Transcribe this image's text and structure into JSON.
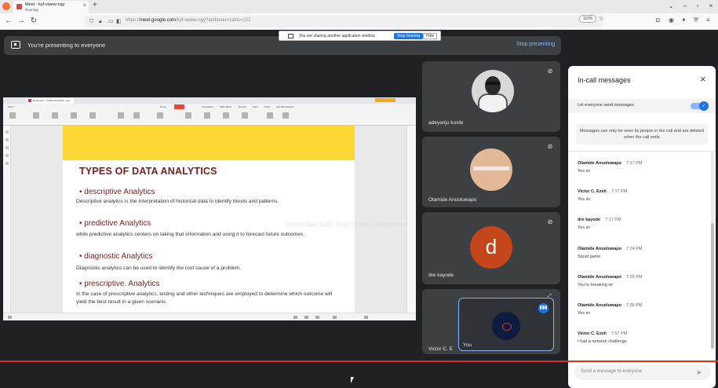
{
  "browser": {
    "tab_title": "Meet - kyf-vwew-ngy",
    "tab_subtitle": "Running",
    "url_prefix": "https://",
    "url_host": "meet.google.com",
    "url_path": "/kyf-vwew-ngy?authuser=1&hs=122",
    "zoom": "110%"
  },
  "share_notice": {
    "text": "You are sharing another application window.",
    "stop_label": "Stop Sharing",
    "hide_label": "Hide"
  },
  "presenting_bar": {
    "text": "You're presenting to everyone",
    "stop_label": "Stop presenting"
  },
  "shared_screen": {
    "app_tab": "Document - TYPES OF DATA...pptx",
    "menus": [
      "Menu",
      "Home",
      "Insert",
      "Animations",
      "Slide Show",
      "Review",
      "View",
      "Tools",
      "Special Features"
    ],
    "slide": {
      "title": "TYPES OF DATA ANALYTICS",
      "sections": [
        {
          "heading": "descriptive Analytics",
          "body": "Descriptive analytics is the interpretation of historical data to identify trends and patterns."
        },
        {
          "heading": "predictive Analytics",
          "body": "while predictive analytics centers on taking that information and using it to forecast future outcomes."
        },
        {
          "heading": "diagnostic Analytics",
          "body": "Diagnostic analytics can be used to identify the root cause of a problem."
        },
        {
          "heading": "prescriptive. Analytics",
          "body": "In the case of prescriptive analytics, testing and other techniques are employed to determine which outcome will yield the best result in a given scenario."
        }
      ]
    }
  },
  "watermark": "Recorded with iTop Screen Recorder",
  "participants": [
    {
      "name": "adeyanju tunde"
    },
    {
      "name": "Olamide Anuoluwapo"
    },
    {
      "name": "dre kayode",
      "initial": "d"
    },
    {
      "name": "Victor C. E"
    }
  ],
  "self": {
    "name": "You"
  },
  "chat": {
    "title": "In-call messages",
    "toggle_label": "Let everyone send messages",
    "notice": "Messages can only be seen by people in the call and are deleted when the call ends",
    "input_placeholder": "Send a message to everyone",
    "messages": [
      {
        "sender": "Olamide Anuoluwapo",
        "time": "7:17 PM",
        "text": "Yes sir"
      },
      {
        "sender": "Victor C. Ezeh",
        "time": "7:17 PM",
        "text": "Yes sir."
      },
      {
        "sender": "dre kayode",
        "time": "7:17 PM",
        "text": "Yes sir"
      },
      {
        "sender": "Olamide Anuoluwapo",
        "time": "7:24 PM",
        "text": "Squid game"
      },
      {
        "sender": "Olamide Anuoluwapo",
        "time": "7:29 PM",
        "text": "You're breaking sir"
      },
      {
        "sender": "Olamide Anuoluwapo",
        "time": "7:36 PM",
        "text": "Yes sir"
      },
      {
        "sender": "Victor C. Ezeh",
        "time": "7:57 PM",
        "text": "I had a network challenge."
      }
    ]
  },
  "colors": {
    "meet_bg": "#202124",
    "tile_bg": "#3c4043",
    "accent_blue": "#1a73e8",
    "slide_title": "#7b1c1c",
    "slide_band": "#fdd835",
    "avatar_d": "#c5461b"
  }
}
